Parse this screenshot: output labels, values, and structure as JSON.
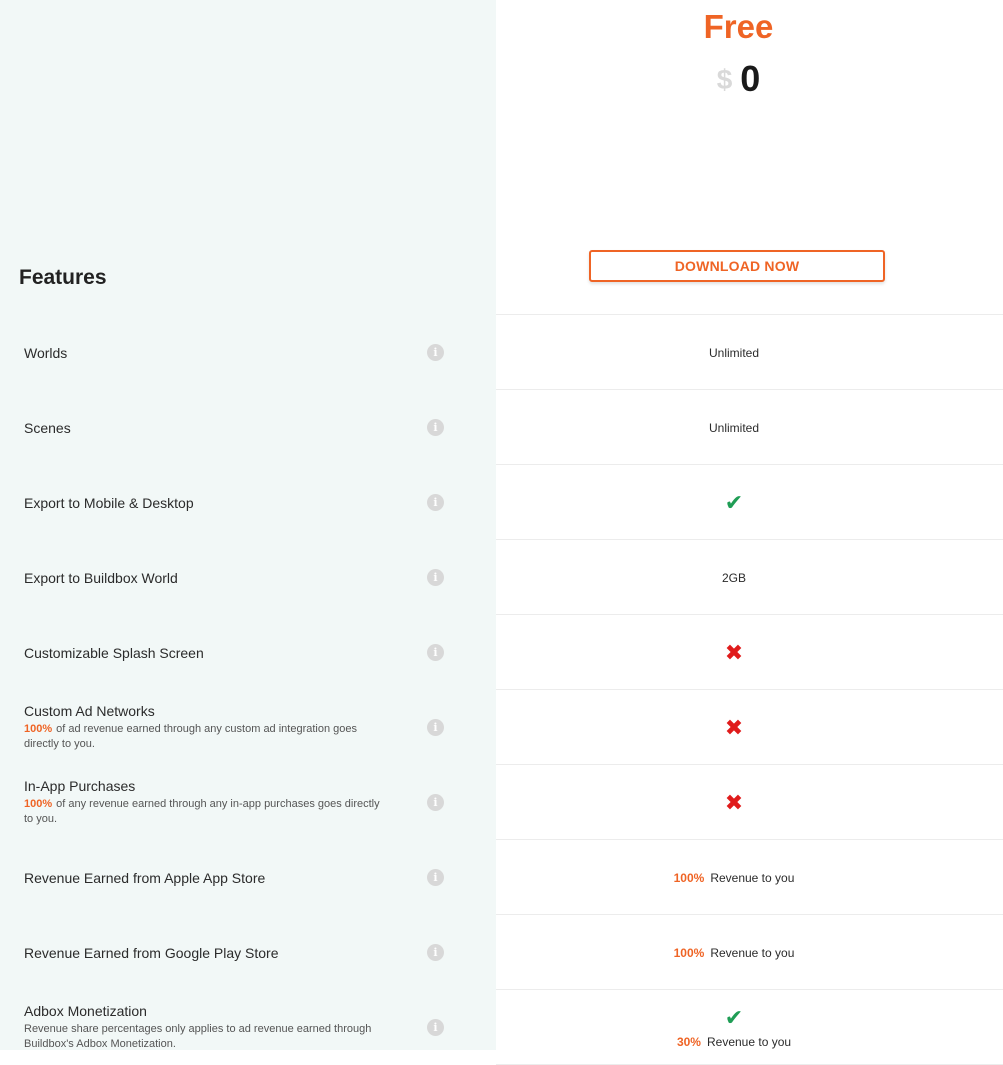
{
  "plan": {
    "name": "Free",
    "currency": "$",
    "price": "0",
    "cta": "DOWNLOAD NOW"
  },
  "features_heading": "Features",
  "colors": {
    "accent": "#ef6425",
    "check": "#1f9d55",
    "cross": "#e01b1b",
    "left_bg": "#f2f8f7"
  },
  "info_icon": "i",
  "rows": [
    {
      "name": "Worlds",
      "value_text": "Unlimited"
    },
    {
      "name": "Scenes",
      "value_text": "Unlimited"
    },
    {
      "name": "Export to Mobile & Desktop",
      "icon": "check-icon",
      "icon_glyph": "✔"
    },
    {
      "name": "Export to Buildbox World",
      "value_text": "2GB"
    },
    {
      "name": "Customizable Splash Screen",
      "icon": "cross-icon",
      "icon_glyph": "✖"
    },
    {
      "name": "Custom Ad Networks",
      "desc_pct": "100%",
      "desc": "of ad revenue earned through any custom ad integration goes directly to you.",
      "icon": "cross-icon",
      "icon_glyph": "✖"
    },
    {
      "name": "In-App Purchases",
      "desc_pct": "100%",
      "desc": "of any revenue earned through any in-app purchases goes directly to you.",
      "icon": "cross-icon",
      "icon_glyph": "✖"
    },
    {
      "name": "Revenue Earned from Apple App Store",
      "value_pct": "100%",
      "value_text": "Revenue to you"
    },
    {
      "name": "Revenue Earned from Google Play Store",
      "value_pct": "100%",
      "value_text": "Revenue to you"
    },
    {
      "name": "Adbox Monetization",
      "desc": "Revenue share percentages only applies to ad revenue earned through Buildbox's Adbox Monetization.",
      "icon": "check-icon",
      "icon_glyph": "✔",
      "value_pct": "30%",
      "value_text": "Revenue to you"
    }
  ]
}
